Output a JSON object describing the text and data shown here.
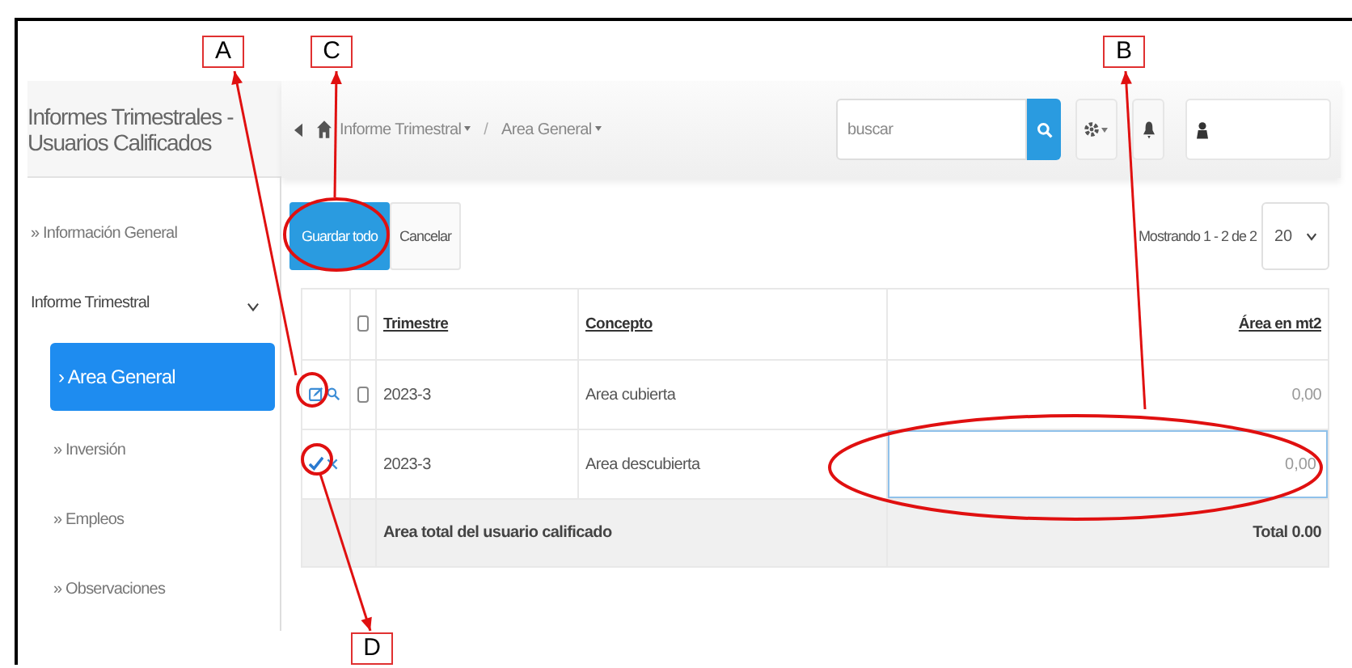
{
  "sidebar": {
    "title": "Informes Trimestrales - Usuarios Calificados",
    "items": [
      {
        "label": "» Información General",
        "selected": false
      },
      {
        "label": "Informe Trimestral",
        "selected": false,
        "expanded": true,
        "children": [
          {
            "label": "› Area General",
            "selected": true
          },
          {
            "label": "» Inversión",
            "selected": false
          },
          {
            "label": "» Empleos",
            "selected": false
          },
          {
            "label": "» Observaciones",
            "selected": false
          }
        ]
      }
    ]
  },
  "topbar": {
    "breadcrumbs": [
      {
        "label": "Informe Trimestral"
      },
      {
        "label": "Area General"
      }
    ],
    "separator": "/",
    "search": {
      "placeholder": "buscar"
    }
  },
  "toolbar": {
    "buttons": [
      {
        "label": "Guardar todo",
        "kind": "primary"
      },
      {
        "label": "Cancelar",
        "kind": "default"
      }
    ],
    "paging": "Mostrando 1 - 2 de 2",
    "page_size": "20"
  },
  "table": {
    "header_checked": false,
    "columns": [
      "Trimestre",
      "Concepto",
      "Área en mt2"
    ],
    "rows": [
      {
        "kind": "view",
        "checked": false,
        "trimestre": "2023-3",
        "concepto": "Area cubierta",
        "area": "0,00"
      },
      {
        "kind": "edit",
        "trimestre": "2023-3",
        "concepto": "Area descubierta",
        "area": "0,00"
      }
    ],
    "footer": {
      "label": "Area total del usuario calificado",
      "total": "Total 0.00"
    }
  },
  "annotations": [
    {
      "label": "A"
    },
    {
      "label": "C"
    },
    {
      "label": "B"
    },
    {
      "label": "D"
    }
  ]
}
